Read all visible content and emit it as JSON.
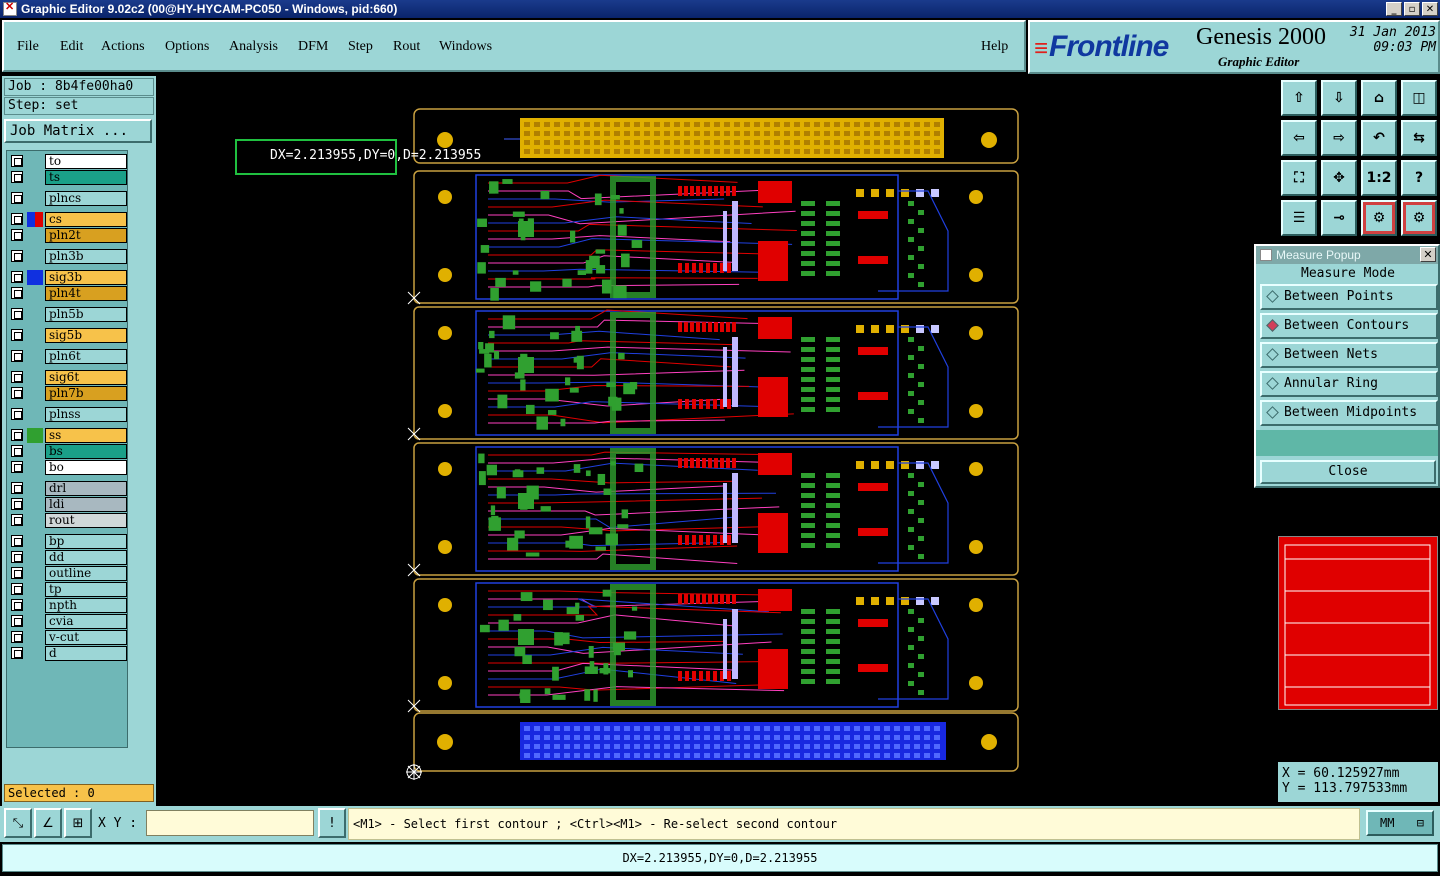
{
  "window": {
    "title": "Graphic Editor 9.02c2 (00@HY-HYCAM-PC050 - Windows, pid:660)"
  },
  "menu": [
    "File",
    "Edit",
    "Actions",
    "Options",
    "Analysis",
    "DFM",
    "Step",
    "Rout",
    "Windows"
  ],
  "help_label": "Help",
  "brand": {
    "logo": "Frontline",
    "product": "Genesis 2000",
    "subtitle": "Graphic Editor",
    "date": "31 Jan 2013",
    "time": "09:03 PM"
  },
  "job": {
    "job": "Job : 8b4fe00ha0",
    "step": "Step: set",
    "matrix_button": "Job Matrix ..."
  },
  "layers": [
    {
      "name": "to",
      "color": "#ffffff",
      "swatch": ""
    },
    {
      "name": "ts",
      "color": "#1aa088",
      "swatch": ""
    },
    {
      "name": "plncs",
      "color": "#9cd6d6",
      "swatch": ""
    },
    {
      "name": "cs",
      "color": "#f7c24a",
      "swatch": "#e00000",
      "active": true
    },
    {
      "name": "pln2t",
      "color": "#d8a020",
      "swatch": ""
    },
    {
      "name": "pln3b",
      "color": "#9cd6d6",
      "swatch": ""
    },
    {
      "name": "sig3b",
      "color": "#f7c24a",
      "swatch": "#1030e0"
    },
    {
      "name": "pln4t",
      "color": "#d8a020",
      "swatch": ""
    },
    {
      "name": "pln5b",
      "color": "#9cd6d6",
      "swatch": ""
    },
    {
      "name": "sig5b",
      "color": "#f7c24a",
      "swatch": ""
    },
    {
      "name": "pln6t",
      "color": "#9cd6d6",
      "swatch": ""
    },
    {
      "name": "sig6t",
      "color": "#f7c24a",
      "swatch": ""
    },
    {
      "name": "pln7b",
      "color": "#d8a020",
      "swatch": ""
    },
    {
      "name": "plnss",
      "color": "#9cd6d6",
      "swatch": ""
    },
    {
      "name": "ss",
      "color": "#f7c24a",
      "swatch": "#30a030"
    },
    {
      "name": "bs",
      "color": "#1aa088",
      "swatch": ""
    },
    {
      "name": "bo",
      "color": "#ffffff",
      "swatch": ""
    },
    {
      "name": "drl",
      "color": "#a8b8c0",
      "swatch": ""
    },
    {
      "name": "ldi",
      "color": "#a8b8c0",
      "swatch": ""
    },
    {
      "name": "rout",
      "color": "#d0d8d8",
      "swatch": ""
    },
    {
      "name": "bp",
      "color": "#9cd6d6",
      "swatch": ""
    },
    {
      "name": "dd",
      "color": "#9cd6d6",
      "swatch": ""
    },
    {
      "name": "outline",
      "color": "#9cd6d6",
      "swatch": ""
    },
    {
      "name": "tp",
      "color": "#9cd6d6",
      "swatch": ""
    },
    {
      "name": "npth",
      "color": "#9cd6d6",
      "swatch": ""
    },
    {
      "name": "cvia",
      "color": "#9cd6d6",
      "swatch": ""
    },
    {
      "name": "v-cut",
      "color": "#9cd6d6",
      "swatch": ""
    },
    {
      "name": "d",
      "color": "#9cd6d6",
      "swatch": ""
    }
  ],
  "selected": "Selected : 0",
  "canvas": {
    "measure_label": "DX=2.213955,DY=0,D=2.213955"
  },
  "measure_popup": {
    "title": "Measure Popup",
    "mode_label": "Measure Mode",
    "options": [
      "Between Points",
      "Between Contours",
      "Between Nets",
      "Annular Ring",
      "Between Midpoints"
    ],
    "selected_option": "Between Contours",
    "close_label": "Close"
  },
  "coords": {
    "x": "X = 60.125927mm",
    "y": "Y = 113.797533mm"
  },
  "bottom": {
    "xy_label": "X Y :",
    "xy_value": "",
    "prompt": "<M1> - Select first contour ; <Ctrl><M1> - Re-select second contour",
    "units": "MM",
    "status": "DX=2.213955,DY=0,D=2.213955"
  },
  "colors": {
    "panel": "#9cd6d6",
    "board_outline": "#c8a040",
    "gold": "#e0b000",
    "trace_red": "#e00000",
    "trace_green": "#30a030",
    "trace_blue": "#2040e0"
  }
}
